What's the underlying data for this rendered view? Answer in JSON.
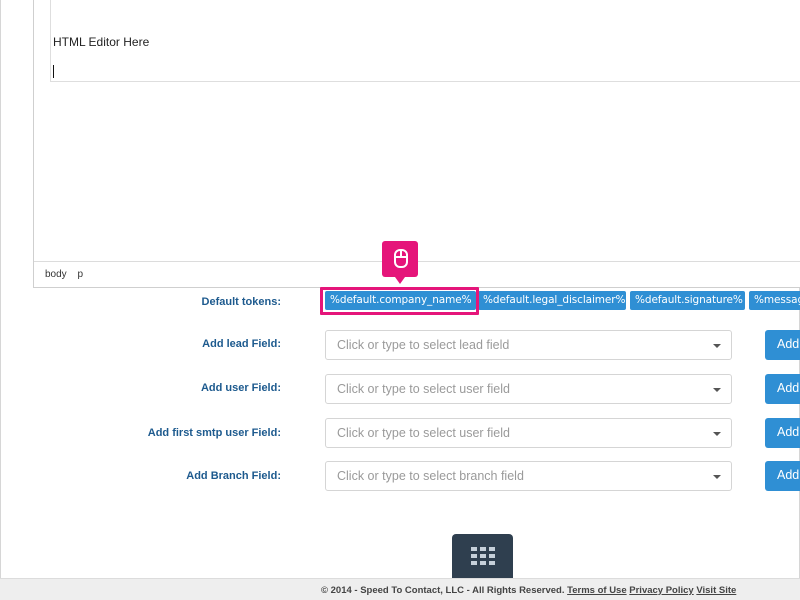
{
  "editor": {
    "content_text": "HTML Editor Here",
    "status_path": [
      "body",
      "p"
    ]
  },
  "tokens": {
    "label": "Default tokens:",
    "items": [
      "%default.company_name%",
      "%default.legal_disclaimer%",
      "%default.signature%",
      "%message"
    ]
  },
  "fields": [
    {
      "label": "Add lead Field:",
      "placeholder": "Click or type to select lead field",
      "button": "Add"
    },
    {
      "label": "Add user Field:",
      "placeholder": "Click or type to select user field",
      "button": "Add"
    },
    {
      "label": "Add first smtp user Field:",
      "placeholder": "Click or type to select user field",
      "button": "Add"
    },
    {
      "label": "Add Branch Field:",
      "placeholder": "Click or type to select branch field",
      "button": "Add"
    }
  ],
  "footer": {
    "copyright": "© 2014 - Speed To Contact, LLC - All Rights Reserved.",
    "terms": "Terms of Use",
    "privacy": "Privacy Policy",
    "visit": "Visit Site"
  },
  "icons": {
    "cursor": "mouse-icon",
    "grid": "grid-icon",
    "dropdown": "chevron-down-icon"
  },
  "colors": {
    "accent": "#2f8fd4",
    "label": "#1d5a8e",
    "highlight": "#e5157a",
    "grid_button": "#2f3f4f"
  }
}
